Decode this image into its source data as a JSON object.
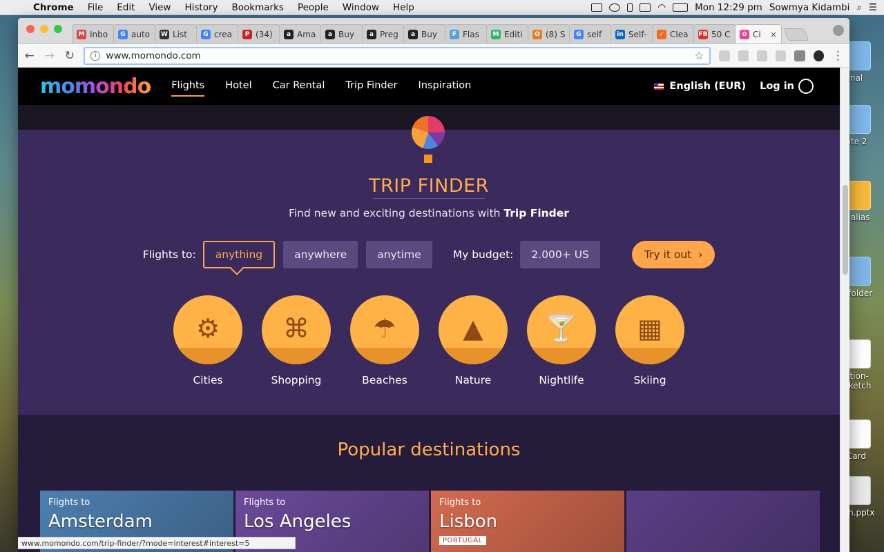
{
  "menubar": {
    "app": "Chrome",
    "items": [
      "File",
      "Edit",
      "View",
      "History",
      "Bookmarks",
      "People",
      "Window",
      "Help"
    ],
    "clock": "Mon 12:29 pm",
    "user": "Sowmya Kidambi"
  },
  "desktop": {
    "icons": [
      "nal",
      "ate 2",
      "h alias",
      "d folder",
      "rition-\n.sketch",
      "Card",
      "itch.pptx"
    ]
  },
  "tabs": [
    {
      "label": "Inbo",
      "fav": "M",
      "color": "#d44"
    },
    {
      "label": "auto",
      "fav": "G",
      "color": "#4285f4"
    },
    {
      "label": "List",
      "fav": "W",
      "color": "#333"
    },
    {
      "label": "crea",
      "fav": "G",
      "color": "#4285f4"
    },
    {
      "label": "(34)",
      "fav": "P",
      "color": "#c8232c"
    },
    {
      "label": "Ama",
      "fav": "a",
      "color": "#222"
    },
    {
      "label": "Buy",
      "fav": "a",
      "color": "#222"
    },
    {
      "label": "Preg",
      "fav": "a",
      "color": "#222"
    },
    {
      "label": "Buy",
      "fav": "a",
      "color": "#222"
    },
    {
      "label": "Flas",
      "fav": "F",
      "color": "#5aa0d8"
    },
    {
      "label": "Editi",
      "fav": "M",
      "color": "#2bb673"
    },
    {
      "label": "(8) S",
      "fav": "O",
      "color": "#e67e22"
    },
    {
      "label": "self",
      "fav": "G",
      "color": "#4285f4"
    },
    {
      "label": "Self-",
      "fav": "in",
      "color": "#0a66c2"
    },
    {
      "label": "Clea",
      "fav": "✓",
      "color": "#f26b1d"
    },
    {
      "label": "50 C",
      "fav": "FB",
      "color": "#d9342b"
    },
    {
      "label": "Ci",
      "fav": "✿",
      "color": "#e84393",
      "active": true
    }
  ],
  "address": {
    "url": "www.momondo.com"
  },
  "site": {
    "logo": "momondo",
    "nav": [
      "Flights",
      "Hotel",
      "Car Rental",
      "Trip Finder",
      "Inspiration"
    ],
    "language": "English (EUR)",
    "login": "Log in"
  },
  "tripfinder": {
    "title": "TRIP FINDER",
    "subtitle_pre": "Find new and exciting destinations with ",
    "subtitle_bold": "Trip Finder",
    "flights_to": "Flights to:",
    "chips": [
      "anything",
      "anywhere",
      "anytime"
    ],
    "budget_label": "My budget:",
    "budget_value": "2.000+ US",
    "try": "Try it out",
    "interests": [
      {
        "label": "Cities",
        "icon": "ferris-wheel"
      },
      {
        "label": "Shopping",
        "icon": "shopping-bag"
      },
      {
        "label": "Beaches",
        "icon": "beach-umbrella"
      },
      {
        "label": "Nature",
        "icon": "mountains-trees"
      },
      {
        "label": "Nightlife",
        "icon": "cocktail"
      },
      {
        "label": "Skiing",
        "icon": "cable-car"
      }
    ]
  },
  "popular": {
    "title": "Popular destinations",
    "cards": [
      {
        "flights_to": "Flights to",
        "city": "Amsterdam",
        "country": "",
        "color": "#4e7fb0"
      },
      {
        "flights_to": "Flights to",
        "city": "Los Angeles",
        "country": "",
        "color": "#6b4a9a"
      },
      {
        "flights_to": "Flights to",
        "city": "Lisbon",
        "country": "PORTUGAL",
        "color": "#d46a4f"
      },
      {
        "flights_to": "",
        "city": "",
        "country": "",
        "color": "#5a3f86"
      }
    ]
  },
  "status": {
    "url": "www.momondo.com/trip-finder/?mode=interest#interest=5"
  }
}
